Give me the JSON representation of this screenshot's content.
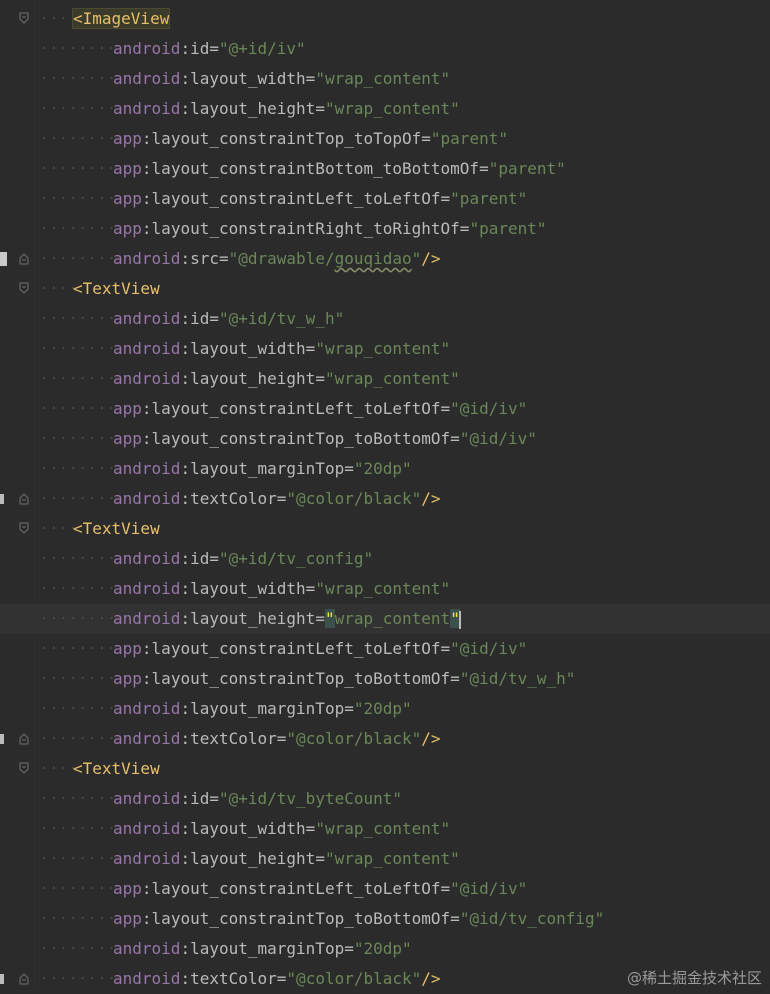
{
  "editor": {
    "lines": [
      {
        "indent": 1,
        "fold": "open",
        "parts": [
          [
            "tag-hl",
            "<ImageView"
          ]
        ]
      },
      {
        "indent": 2,
        "parts": [
          [
            "ns",
            "android"
          ],
          [
            "colon",
            ":"
          ],
          [
            "attr",
            "id"
          ],
          [
            "eq",
            "="
          ],
          [
            "val",
            "\"@+id/iv\""
          ]
        ]
      },
      {
        "indent": 2,
        "parts": [
          [
            "ns",
            "android"
          ],
          [
            "colon",
            ":"
          ],
          [
            "attr",
            "layout_width"
          ],
          [
            "eq",
            "="
          ],
          [
            "val",
            "\"wrap_content\""
          ]
        ]
      },
      {
        "indent": 2,
        "parts": [
          [
            "ns",
            "android"
          ],
          [
            "colon",
            ":"
          ],
          [
            "attr",
            "layout_height"
          ],
          [
            "eq",
            "="
          ],
          [
            "val",
            "\"wrap_content\""
          ]
        ]
      },
      {
        "indent": 2,
        "parts": [
          [
            "ns",
            "app"
          ],
          [
            "colon",
            ":"
          ],
          [
            "attr",
            "layout_constraintTop_toTopOf"
          ],
          [
            "eq",
            "="
          ],
          [
            "val",
            "\"parent\""
          ]
        ]
      },
      {
        "indent": 2,
        "parts": [
          [
            "ns",
            "app"
          ],
          [
            "colon",
            ":"
          ],
          [
            "attr",
            "layout_constraintBottom_toBottomOf"
          ],
          [
            "eq",
            "="
          ],
          [
            "val",
            "\"parent\""
          ]
        ]
      },
      {
        "indent": 2,
        "parts": [
          [
            "ns",
            "app"
          ],
          [
            "colon",
            ":"
          ],
          [
            "attr",
            "layout_constraintLeft_toLeftOf"
          ],
          [
            "eq",
            "="
          ],
          [
            "val",
            "\"parent\""
          ]
        ]
      },
      {
        "indent": 2,
        "parts": [
          [
            "ns",
            "app"
          ],
          [
            "colon",
            ":"
          ],
          [
            "attr",
            "layout_constraintRight_toRightOf"
          ],
          [
            "eq",
            "="
          ],
          [
            "val",
            "\"parent\""
          ]
        ]
      },
      {
        "indent": 2,
        "fold": "close",
        "gutter": "image",
        "parts": [
          [
            "ns",
            "android"
          ],
          [
            "colon",
            ":"
          ],
          [
            "attr",
            "src"
          ],
          [
            "eq",
            "="
          ],
          [
            "val",
            "\"@drawable/"
          ],
          [
            "squig",
            "gouqidao"
          ],
          [
            "val",
            "\""
          ],
          [
            "end",
            "/>"
          ]
        ]
      },
      {
        "indent": 1,
        "fold": "open",
        "parts": [
          [
            "tag",
            "<TextView"
          ]
        ]
      },
      {
        "indent": 2,
        "parts": [
          [
            "ns",
            "android"
          ],
          [
            "colon",
            ":"
          ],
          [
            "attr",
            "id"
          ],
          [
            "eq",
            "="
          ],
          [
            "val",
            "\"@+id/tv_w_h\""
          ]
        ]
      },
      {
        "indent": 2,
        "parts": [
          [
            "ns",
            "android"
          ],
          [
            "colon",
            ":"
          ],
          [
            "attr",
            "layout_width"
          ],
          [
            "eq",
            "="
          ],
          [
            "val",
            "\"wrap_content\""
          ]
        ]
      },
      {
        "indent": 2,
        "parts": [
          [
            "ns",
            "android"
          ],
          [
            "colon",
            ":"
          ],
          [
            "attr",
            "layout_height"
          ],
          [
            "eq",
            "="
          ],
          [
            "val",
            "\"wrap_content\""
          ]
        ]
      },
      {
        "indent": 2,
        "parts": [
          [
            "ns",
            "app"
          ],
          [
            "colon",
            ":"
          ],
          [
            "attr",
            "layout_constraintLeft_toLeftOf"
          ],
          [
            "eq",
            "="
          ],
          [
            "val",
            "\"@id/iv\""
          ]
        ]
      },
      {
        "indent": 2,
        "parts": [
          [
            "ns",
            "app"
          ],
          [
            "colon",
            ":"
          ],
          [
            "attr",
            "layout_constraintTop_toBottomOf"
          ],
          [
            "eq",
            "="
          ],
          [
            "val",
            "\"@id/iv\""
          ]
        ]
      },
      {
        "indent": 2,
        "parts": [
          [
            "ns",
            "android"
          ],
          [
            "colon",
            ":"
          ],
          [
            "attr",
            "layout_marginTop"
          ],
          [
            "eq",
            "="
          ],
          [
            "val",
            "\"20dp\""
          ]
        ]
      },
      {
        "indent": 2,
        "fold": "close",
        "gutter": "color",
        "parts": [
          [
            "ns",
            "android"
          ],
          [
            "colon",
            ":"
          ],
          [
            "attr",
            "textColor"
          ],
          [
            "eq",
            "="
          ],
          [
            "val",
            "\"@color/black\""
          ],
          [
            "end",
            "/>"
          ]
        ]
      },
      {
        "indent": 1,
        "fold": "open",
        "parts": [
          [
            "tag",
            "<TextView"
          ]
        ]
      },
      {
        "indent": 2,
        "parts": [
          [
            "ns",
            "android"
          ],
          [
            "colon",
            ":"
          ],
          [
            "attr",
            "id"
          ],
          [
            "eq",
            "="
          ],
          [
            "val",
            "\"@+id/tv_config\""
          ]
        ]
      },
      {
        "indent": 2,
        "parts": [
          [
            "ns",
            "android"
          ],
          [
            "colon",
            ":"
          ],
          [
            "attr",
            "layout_width"
          ],
          [
            "eq",
            "="
          ],
          [
            "val",
            "\"wrap_content\""
          ]
        ]
      },
      {
        "indent": 2,
        "current": true,
        "parts": [
          [
            "ns",
            "android"
          ],
          [
            "colon",
            ":"
          ],
          [
            "attr",
            "layout_height"
          ],
          [
            "eq",
            "="
          ],
          [
            "qm",
            "\""
          ],
          [
            "val",
            "wrap_content"
          ],
          [
            "qm",
            "\""
          ],
          [
            "caret",
            ""
          ]
        ]
      },
      {
        "indent": 2,
        "parts": [
          [
            "ns",
            "app"
          ],
          [
            "colon",
            ":"
          ],
          [
            "attr",
            "layout_constraintLeft_toLeftOf"
          ],
          [
            "eq",
            "="
          ],
          [
            "val",
            "\"@id/iv\""
          ]
        ]
      },
      {
        "indent": 2,
        "parts": [
          [
            "ns",
            "app"
          ],
          [
            "colon",
            ":"
          ],
          [
            "attr",
            "layout_constraintTop_toBottomOf"
          ],
          [
            "eq",
            "="
          ],
          [
            "val",
            "\"@id/tv_w_h\""
          ]
        ]
      },
      {
        "indent": 2,
        "parts": [
          [
            "ns",
            "android"
          ],
          [
            "colon",
            ":"
          ],
          [
            "attr",
            "layout_marginTop"
          ],
          [
            "eq",
            "="
          ],
          [
            "val",
            "\"20dp\""
          ]
        ]
      },
      {
        "indent": 2,
        "fold": "close",
        "gutter": "color",
        "parts": [
          [
            "ns",
            "android"
          ],
          [
            "colon",
            ":"
          ],
          [
            "attr",
            "textColor"
          ],
          [
            "eq",
            "="
          ],
          [
            "val",
            "\"@color/black\""
          ],
          [
            "end",
            "/>"
          ]
        ]
      },
      {
        "indent": 1,
        "fold": "open",
        "parts": [
          [
            "tag",
            "<TextView"
          ]
        ]
      },
      {
        "indent": 2,
        "parts": [
          [
            "ns",
            "android"
          ],
          [
            "colon",
            ":"
          ],
          [
            "attr",
            "id"
          ],
          [
            "eq",
            "="
          ],
          [
            "val",
            "\"@+id/tv_byteCount\""
          ]
        ]
      },
      {
        "indent": 2,
        "parts": [
          [
            "ns",
            "android"
          ],
          [
            "colon",
            ":"
          ],
          [
            "attr",
            "layout_width"
          ],
          [
            "eq",
            "="
          ],
          [
            "val",
            "\"wrap_content\""
          ]
        ]
      },
      {
        "indent": 2,
        "parts": [
          [
            "ns",
            "android"
          ],
          [
            "colon",
            ":"
          ],
          [
            "attr",
            "layout_height"
          ],
          [
            "eq",
            "="
          ],
          [
            "val",
            "\"wrap_content\""
          ]
        ]
      },
      {
        "indent": 2,
        "parts": [
          [
            "ns",
            "app"
          ],
          [
            "colon",
            ":"
          ],
          [
            "attr",
            "layout_constraintLeft_toLeftOf"
          ],
          [
            "eq",
            "="
          ],
          [
            "val",
            "\"@id/iv\""
          ]
        ]
      },
      {
        "indent": 2,
        "parts": [
          [
            "ns",
            "app"
          ],
          [
            "colon",
            ":"
          ],
          [
            "attr",
            "layout_constraintTop_toBottomOf"
          ],
          [
            "eq",
            "="
          ],
          [
            "val",
            "\"@id/tv_config\""
          ]
        ]
      },
      {
        "indent": 2,
        "parts": [
          [
            "ns",
            "android"
          ],
          [
            "colon",
            ":"
          ],
          [
            "attr",
            "layout_marginTop"
          ],
          [
            "eq",
            "="
          ],
          [
            "val",
            "\"20dp\""
          ]
        ]
      },
      {
        "indent": 2,
        "fold": "close",
        "gutter": "color",
        "parts": [
          [
            "ns",
            "android"
          ],
          [
            "colon",
            ":"
          ],
          [
            "attr",
            "textColor"
          ],
          [
            "eq",
            "="
          ],
          [
            "val",
            "\"@color/black\""
          ],
          [
            "end",
            "/>"
          ]
        ]
      }
    ]
  },
  "watermark": "@稀土掘金技术社区",
  "colors": {
    "background": "#2b2b2b",
    "tag": "#e8bf6a",
    "namespace": "#9876aa",
    "attribute": "#bababa",
    "value": "#6a8759",
    "matched_quote": "#ffef28"
  }
}
